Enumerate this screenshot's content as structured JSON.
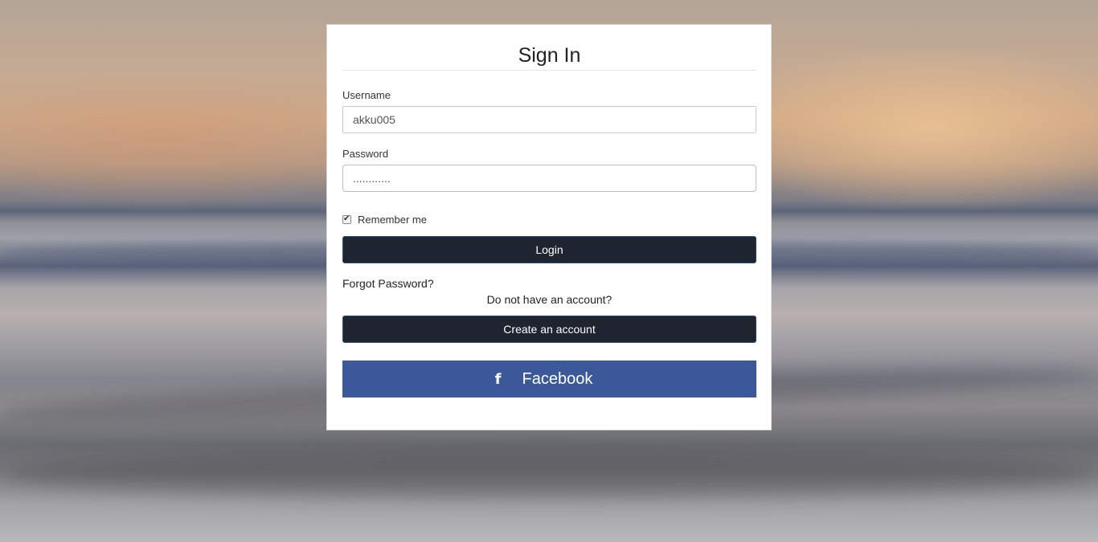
{
  "form": {
    "title": "Sign In",
    "username_label": "Username",
    "username_value": "akku005",
    "password_label": "Password",
    "password_value": "............",
    "remember_label": "Remember me",
    "remember_checked": true,
    "login_label": "Login",
    "forgot_label": "Forgot Password?",
    "no_account_text": "Do not have an account?",
    "create_account_label": "Create an account",
    "facebook_label": "Facebook",
    "facebook_icon": "f"
  },
  "colors": {
    "button_dark": "#1e2430",
    "facebook_blue": "#3b5998"
  }
}
